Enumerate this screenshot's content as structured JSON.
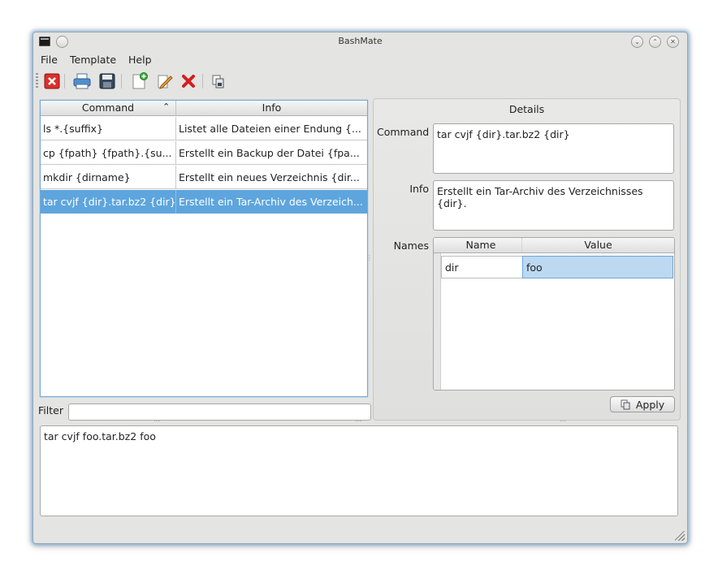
{
  "window": {
    "title": "BashMate"
  },
  "menu": {
    "file": "File",
    "template": "Template",
    "help": "Help"
  },
  "toolbar": {
    "icons": [
      "close-red-icon",
      "print-icon",
      "save-icon",
      "new-document-icon",
      "edit-icon",
      "delete-icon",
      "copy-icon"
    ]
  },
  "commands": {
    "headers": {
      "command": "Command",
      "info": "Info"
    },
    "rows": [
      {
        "command": "ls *.{suffix}",
        "info": "Listet alle Dateien einer Endung {..."
      },
      {
        "command": "cp {fpath} {fpath}.{su...",
        "info": "Erstellt ein Backup der Datei {fpa..."
      },
      {
        "command": "mkdir {dirname}",
        "info": "Erstellt ein neues Verzeichnis {dir..."
      },
      {
        "command": "tar cvjf {dir}.tar.bz2 {dir}",
        "info": "Erstellt ein Tar-Archiv des Verzeich..."
      }
    ],
    "selected_index": 3
  },
  "filter": {
    "label": "Filter",
    "value": ""
  },
  "details": {
    "title": "Details",
    "command_label": "Command",
    "command_value": "tar cvjf {dir}.tar.bz2 {dir}",
    "info_label": "Info",
    "info_value": "Erstellt ein Tar-Archiv des Verzeichnisses {dir}.",
    "names_label": "Names",
    "names_headers": {
      "name": "Name",
      "value": "Value"
    },
    "names_rows": [
      {
        "name": "dir",
        "value": "foo"
      }
    ],
    "apply_label": "Apply"
  },
  "output": {
    "text": "tar cvjf foo.tar.bz2 foo"
  },
  "colors": {
    "selection": "#5ea5dd",
    "window_bg": "#e4e4e2",
    "focus_border": "#74a7d6"
  }
}
